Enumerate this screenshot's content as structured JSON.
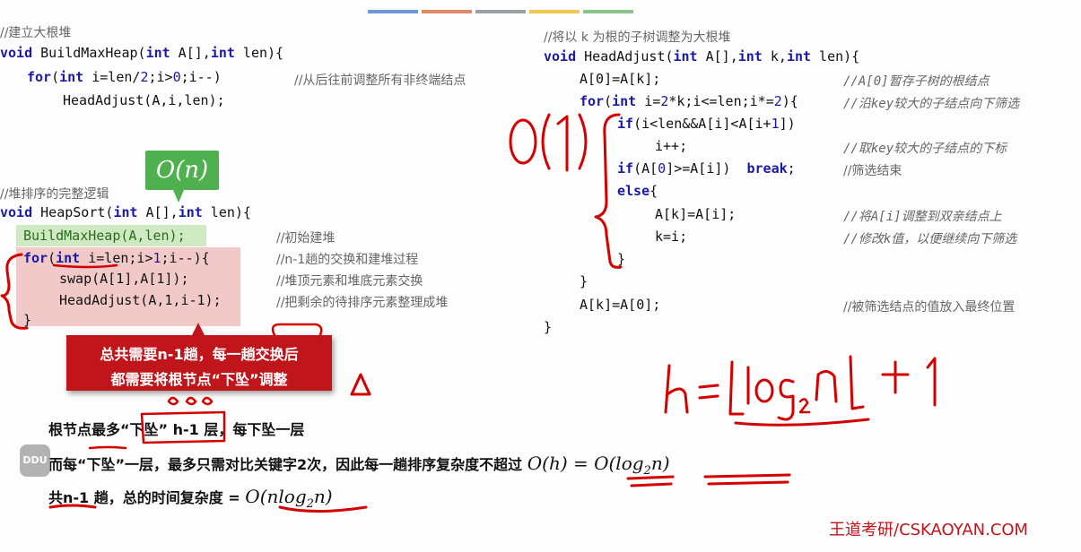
{
  "left": {
    "c1": "//建立大根堆",
    "l1": [
      "void",
      " BuildMaxHeap(",
      "int",
      " A[],",
      "int",
      " len){"
    ],
    "l2": [
      "for",
      "(",
      "int",
      " i=len/",
      "2",
      ";i>",
      "0",
      ";i--)"
    ],
    "l2c": "//从后往前调整所有非终端结点",
    "l3": "HeadAdjust(A,i,len);",
    "c2": "//堆排序的完整逻辑",
    "l4": [
      "void",
      " HeapSort(",
      "int",
      " A[],",
      "int",
      " len){"
    ],
    "l5": "BuildMaxHeap(A,len);",
    "l5c": "//初始建堆",
    "l6": [
      "for",
      "(",
      "int",
      " i=len;i>",
      "1",
      ";i--){"
    ],
    "l6c": "//n-1趟的交换和建堆过程",
    "l7": "swap(A[1],A[1]);",
    "l7c": "//堆顶元素和堆底元素交换",
    "l8": "HeadAdjust(A,1,i-1);",
    "l8c": "//把剩余的待排序元素整理成堆",
    "l9": "}"
  },
  "right": {
    "c1": "//将以 k 为根的子树调整为大根堆",
    "l1": [
      "void",
      " HeadAdjust(",
      "int",
      " A[],",
      "int",
      " k,",
      "int",
      " len){"
    ],
    "l2": "A[0]=A[k];",
    "l2c": "//A[0]暂存子树的根结点",
    "l3": [
      "for",
      "(",
      "int",
      " i=",
      "2",
      "*k;i<=len;i*=",
      "2",
      "){"
    ],
    "l3c": "//沿key较大的子结点向下筛选",
    "l4": [
      "if",
      "(i<len&&A[i]<A[i+",
      "1",
      "])"
    ],
    "l5": "i++;",
    "l5c": "//取key较大的子结点的下标",
    "l6": [
      "if",
      "(A[",
      "0",
      "]>=A[i])  ",
      "break",
      ";"
    ],
    "l6c": "//筛选结束",
    "l7": [
      "else",
      "{"
    ],
    "l8": "A[k]=A[i];",
    "l8c": "//将A[i]调整到双亲结点上",
    "l9": "k=i;",
    "l9c": "//修改k值，以便继续向下筛选",
    "l10": "}",
    "l11": "}",
    "l12": "A[k]=A[0];",
    "l12c": "//被筛选结点的值放入最终位置",
    "l13": "}"
  },
  "callout_on": "O(n)",
  "red_box": {
    "line1": "总共需要n-1趟，每一趟交换后",
    "line2": "都需要将根节点“下坠”调整"
  },
  "notes": {
    "n1_a": "根节点最多",
    "n1_b": "“下坠” h-1",
    "n1_c": " 层，每下坠一层",
    "n2_a": "而每“下坠”一层，最多只需对比关键字2次，因此每一趟排序复杂度不超过 ",
    "n2_b": "O(h) = O(log",
    "n2_sub": "2",
    "n2_c": "n)",
    "n3_a": "共n-1 趟，总的时间复杂度 = ",
    "n3_b": "O(nlog",
    "n3_sub": "2",
    "n3_c": "n)"
  },
  "handwriting": {
    "o1": "O(1)",
    "h_formula": "h=⌊log₂n⌋+1"
  },
  "watermark": "王道考研/CSKAOYAN.COM",
  "badge": "DDU",
  "colors": {
    "keyword": "#1a1aa6",
    "comment": "#666666",
    "green_highlight": "#cfeac3",
    "red_highlight": "#f2c9c9",
    "red_box": "#c0151b",
    "ink": "#d40000"
  }
}
